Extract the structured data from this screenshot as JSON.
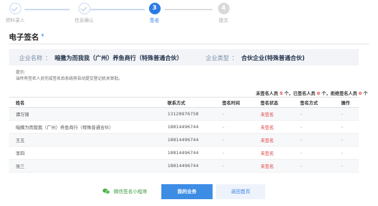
{
  "steps": [
    {
      "label": "资料录入",
      "state": "done"
    },
    {
      "label": "信息确认",
      "state": "done"
    },
    {
      "label": "签名",
      "number": "3",
      "state": "active"
    },
    {
      "label": "提交",
      "number": "4",
      "state": "todo"
    }
  ],
  "section": {
    "title": "电子签名",
    "chevron": "»"
  },
  "company": {
    "name_label": "企业名称",
    "name_sep": "：",
    "name_value": "暗撒为而我我（广州）养鱼商行（特殊普通合伙）",
    "type_label": "企业类型",
    "type_sep": "：",
    "type_value": "合伙企业(特殊普通合伙)"
  },
  "tips": {
    "title": "提示:",
    "text": "当所有签名人员完成签名后系统将自动提交登记机关审批。"
  },
  "counts": {
    "unsigned_prefix": "未签名人员",
    "unsigned_count": "5",
    "unsigned_suffix": "个，已签名人员",
    "signed_count": "0",
    "signed_suffix": "个，拒绝签名人员",
    "rejected_count": "0",
    "rejected_suffix": "个"
  },
  "table": {
    "headers": [
      "姓名",
      "联系方式",
      "签名时间",
      "签名状态",
      "签名方式",
      "操作"
    ],
    "rows": [
      {
        "name": "谭万锦",
        "phone": "13129976758",
        "time": "–",
        "status": "未签名",
        "method": "–",
        "action": "–"
      },
      {
        "name": "暗撒为而我我（广州）养鱼商行（特殊普通合伙）",
        "phone": "18814496744",
        "time": "–",
        "status": "未签名",
        "method": "–",
        "action": "–"
      },
      {
        "name": "王五",
        "phone": "18814496744",
        "time": "–",
        "status": "未签名",
        "method": "–",
        "action": "–"
      },
      {
        "name": "李四",
        "phone": "18814496744",
        "time": "–",
        "status": "未签名",
        "method": "–",
        "action": "–"
      },
      {
        "name": "张三",
        "phone": "18814496744",
        "time": "–",
        "status": "未签名",
        "method": "–",
        "action": "–"
      }
    ]
  },
  "footer": {
    "mini_program": "微信签名小程序",
    "my_business": "我的业务",
    "back_home": "返回首页"
  },
  "colors": {
    "accent": "#2c7be5",
    "danger": "#e23b3b",
    "wechat": "#3a9a3a"
  }
}
